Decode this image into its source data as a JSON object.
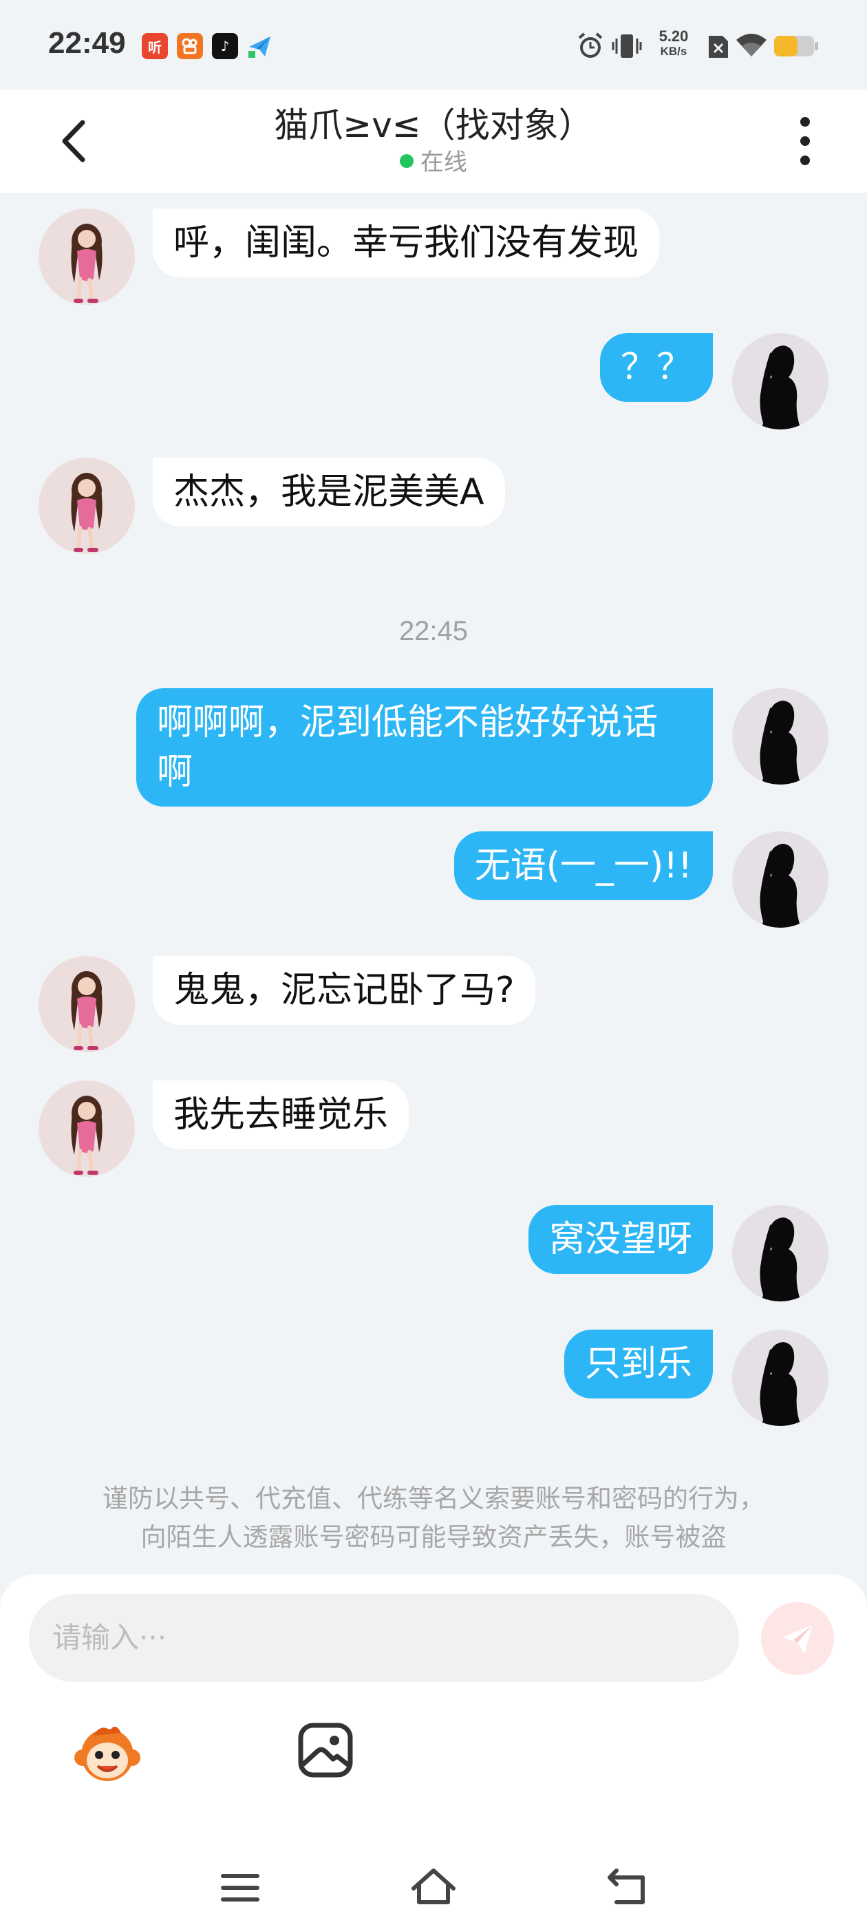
{
  "status_bar": {
    "time": "22:49",
    "app_icons": [
      {
        "name": "tingshu-app-icon",
        "glyph": "听",
        "color": "#e8462f"
      },
      {
        "name": "kuaishou-app-icon",
        "glyph": "",
        "color": "#f27524"
      },
      {
        "name": "tiktok-app-icon",
        "glyph": "♪",
        "color": "#111111"
      },
      {
        "name": "paper-plane-app-icon",
        "glyph": "",
        "color": "#ffffff"
      }
    ],
    "network_speed_value": "5.20",
    "network_speed_unit": "KB/s"
  },
  "header": {
    "title": "猫爪≥v≤（找对象）",
    "status": "在线",
    "status_color": "#22c55e"
  },
  "messages": [
    {
      "side": "in",
      "text": "呼，闺闺。幸亏我们没有发现"
    },
    {
      "side": "out",
      "text": "？？"
    },
    {
      "side": "in",
      "text": "杰杰，我是泥美美A"
    },
    {
      "side": "out",
      "text": "啊啊啊，泥到低能不能好好说话啊"
    },
    {
      "side": "out",
      "text": "无语(一_一)!!"
    },
    {
      "side": "in",
      "text": "鬼鬼，泥忘记卧了马?"
    },
    {
      "side": "in",
      "text": "我先去睡觉乐"
    },
    {
      "side": "out",
      "text": "窝没望呀"
    },
    {
      "side": "out",
      "text": "只到乐"
    }
  ],
  "timestamp": "22:45",
  "warning": {
    "line1": "谨防以共号、代充值、代练等名义索要账号和密码的行为，",
    "line2": "向陌生人透露账号密码可能导致资产丢失，账号被盗"
  },
  "input": {
    "placeholder": "请输入···"
  },
  "colors": {
    "outgoing_bubble": "#2cb6f5",
    "incoming_bubble": "#ffffff",
    "background": "#f1f4f7",
    "send_button": "#fde6e5"
  }
}
